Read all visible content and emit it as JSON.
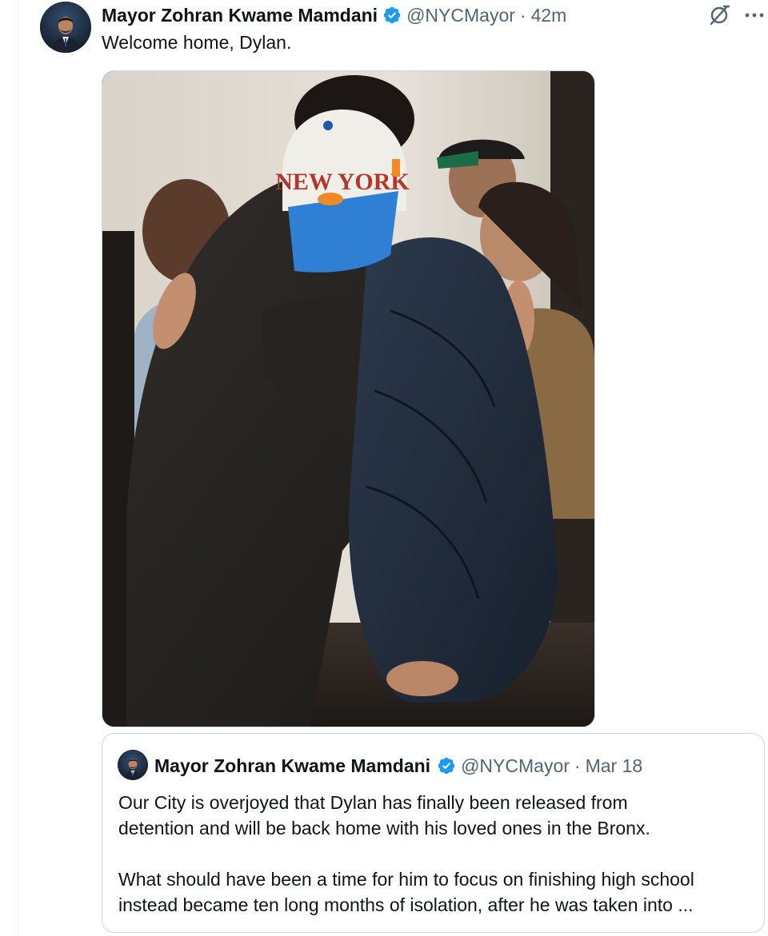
{
  "post": {
    "author_name": "Mayor Zohran Kwame Mamdani",
    "handle": "@NYCMayor",
    "separator": "·",
    "time": "42m",
    "text": "Welcome home, Dylan.",
    "media_icon": "photo",
    "cap_text": "NEW YORK"
  },
  "actions": {
    "grok_icon": "grok-slash-icon",
    "more_icon": "more-horizontal-icon"
  },
  "quote": {
    "author_name": "Mayor Zohran Kwame Mamdani",
    "handle": "@NYCMayor",
    "separator": "·",
    "time": "Mar 18",
    "lines": [
      "Our City is overjoyed that Dylan has finally been released from",
      "detention and will be back home with his loved ones in the Bronx.",
      "",
      "What should have been a time for him to focus on finishing high school",
      "instead became ten long months of isolation, after he was taken into ..."
    ]
  },
  "colors": {
    "text": "#0f1419",
    "secondary": "#536471",
    "verified": "#1d9bf0",
    "border": "#cfd9de"
  }
}
